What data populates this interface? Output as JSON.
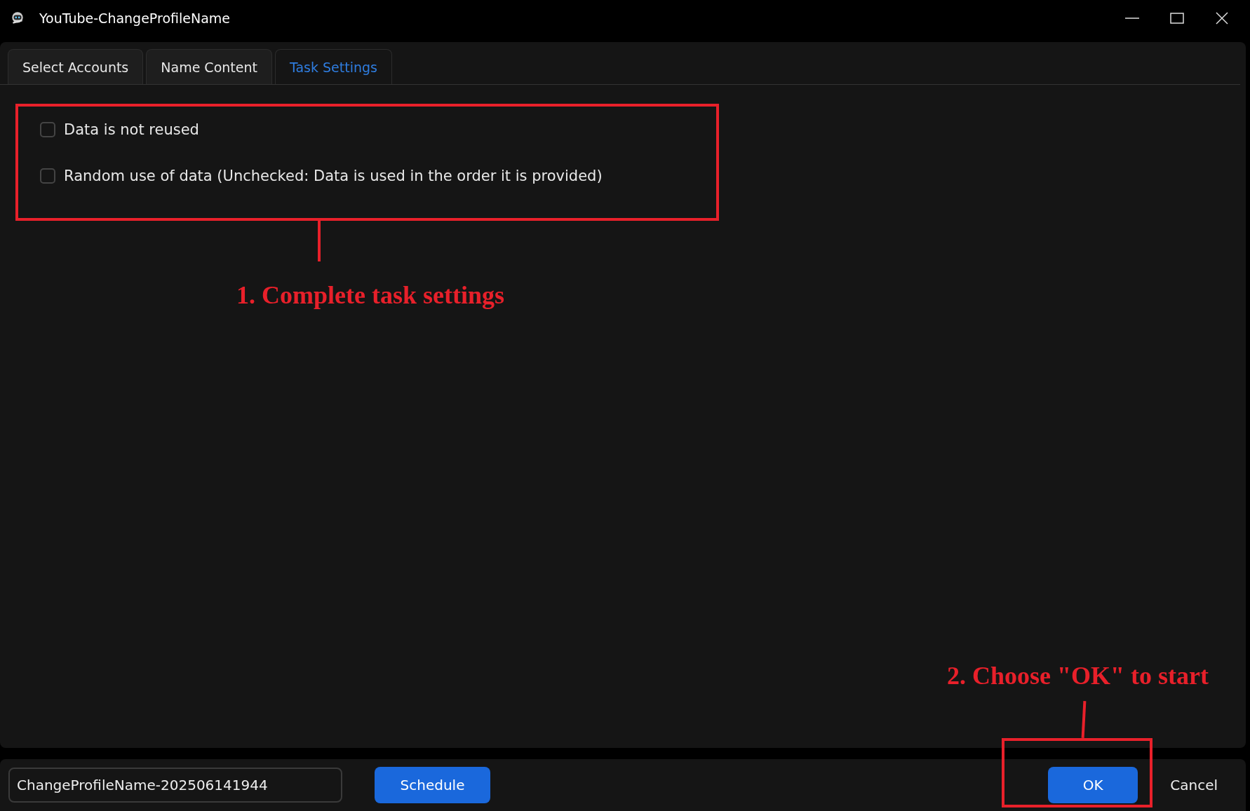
{
  "window": {
    "title": "YouTube-ChangeProfileName"
  },
  "tabs": [
    {
      "label": "Select Accounts",
      "selected": false
    },
    {
      "label": "Name Content",
      "selected": false
    },
    {
      "label": "Task Settings",
      "selected": true
    }
  ],
  "options": [
    {
      "label": "Data is not reused",
      "checked": false
    },
    {
      "label": "Random use of data (Unchecked: Data is used in the order it is provided)",
      "checked": false
    }
  ],
  "footer": {
    "task_name": "ChangeProfileName-202506141944",
    "schedule_button": "Schedule",
    "ok_button": "OK",
    "cancel_button": "Cancel"
  },
  "annotations": {
    "options_callout": {
      "text": "1. Complete task settings"
    },
    "ok_callout": {
      "text": "2. Choose \"OK\" to start"
    }
  }
}
